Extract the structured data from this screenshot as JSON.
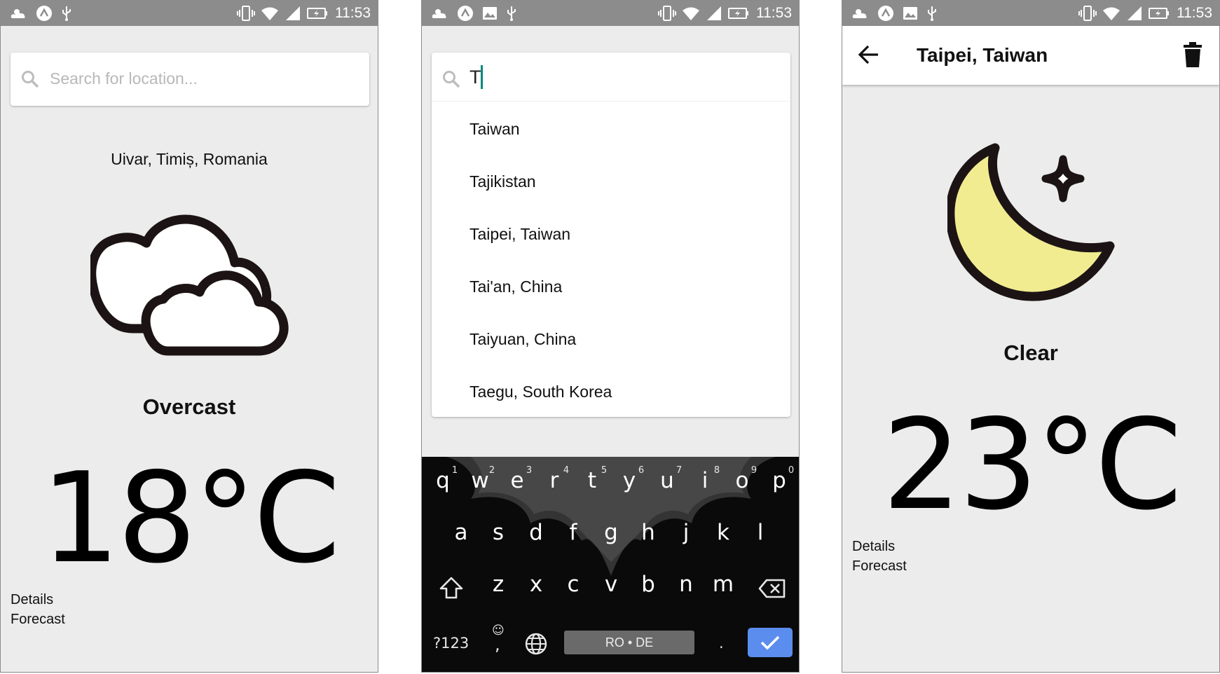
{
  "status_bar": {
    "time": "11:53",
    "left_icons_screen1": [
      "weather-icon",
      "app-a-icon",
      "usb-icon"
    ],
    "left_icons_other": [
      "weather-icon",
      "app-a-icon",
      "image-icon",
      "usb-icon"
    ],
    "right_icons": [
      "vibrate-icon",
      "wifi-icon",
      "signal-icon",
      "battery-charging-icon"
    ]
  },
  "screen1": {
    "search_placeholder": "Search for location...",
    "location": "Uivar, Timiș, Romania",
    "icon": "cloud-icon",
    "condition": "Overcast",
    "temperature": "18°C",
    "links": [
      "Details",
      "Forecast"
    ]
  },
  "screen2": {
    "search_value": "T",
    "suggestions": [
      "Taiwan",
      "Tajikistan",
      "Taipei, Taiwan",
      "Tai'an, China",
      "Taiyuan, China",
      "Taegu, South Korea"
    ],
    "keyboard": {
      "row1": [
        "q",
        "w",
        "e",
        "r",
        "t",
        "y",
        "u",
        "i",
        "o",
        "p"
      ],
      "row1_hints": [
        "1",
        "2",
        "3",
        "4",
        "5",
        "6",
        "7",
        "8",
        "9",
        "0"
      ],
      "row2": [
        "a",
        "s",
        "d",
        "f",
        "g",
        "h",
        "j",
        "k",
        "l"
      ],
      "row3": [
        "z",
        "x",
        "c",
        "v",
        "b",
        "n",
        "m"
      ],
      "symbols_label": "?123",
      "comma_label": ",",
      "emoji_label": "☺",
      "space_label": "RO • DE",
      "period_label": "."
    }
  },
  "screen3": {
    "title": "Taipei, Taiwan",
    "icon": "moon-icon",
    "condition": "Clear",
    "temperature": "23°C",
    "links": [
      "Details",
      "Forecast"
    ]
  },
  "colors": {
    "status_bar": "#8c8c8c",
    "screen_background": "#ececec",
    "moon_fill": "#f2ec91",
    "keyboard_done": "#5b8def",
    "cursor": "#00897b"
  }
}
